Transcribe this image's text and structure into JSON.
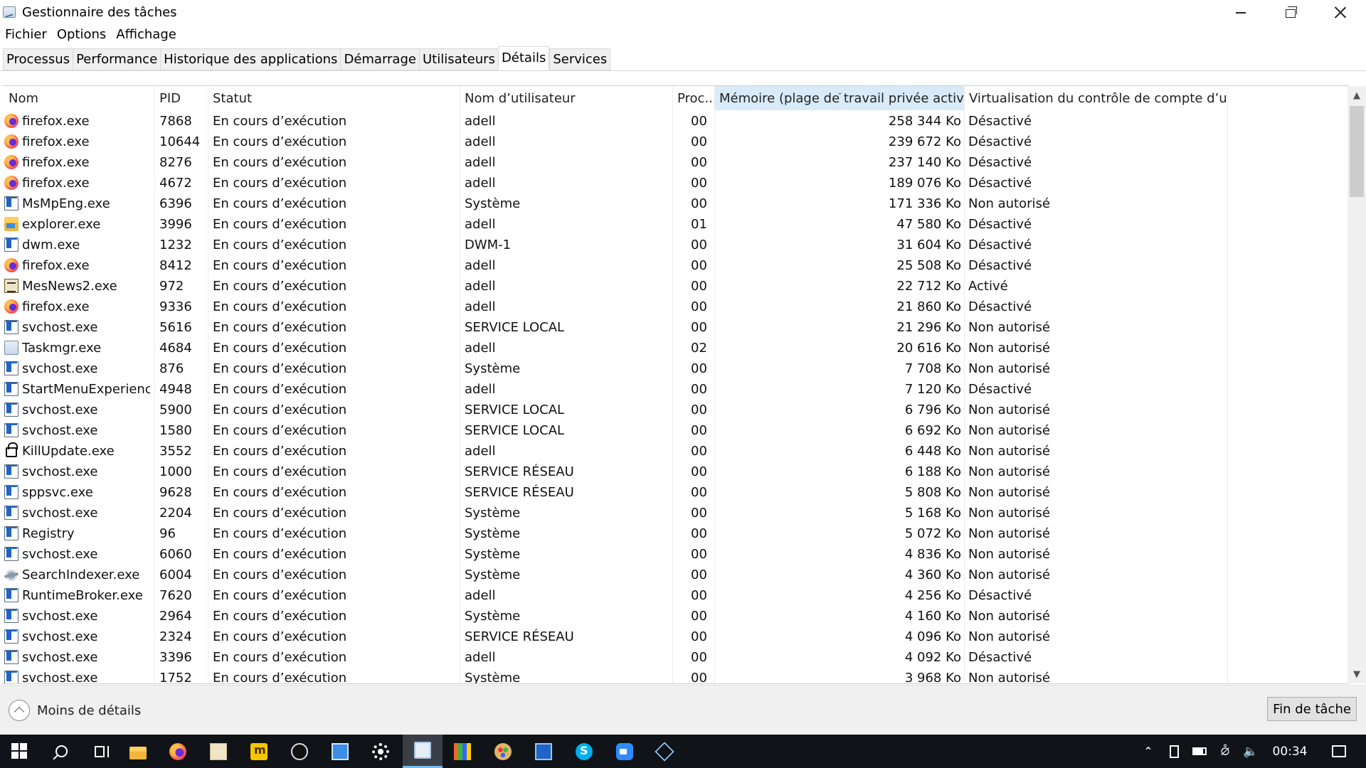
{
  "window": {
    "title": "Gestionnaire des tâches"
  },
  "menu": [
    "Fichier",
    "Options",
    "Affichage"
  ],
  "tabs": [
    {
      "label": "Processus",
      "active": false
    },
    {
      "label": "Performance",
      "active": false
    },
    {
      "label": "Historique des applications",
      "active": false
    },
    {
      "label": "Démarrage",
      "active": false
    },
    {
      "label": "Utilisateurs",
      "active": false
    },
    {
      "label": "Détails",
      "active": true
    },
    {
      "label": "Services",
      "active": false
    }
  ],
  "columns": {
    "name": "Nom",
    "pid": "PID",
    "status": "Statut",
    "user": "Nom d’utilisateur",
    "cpu": "Proc...",
    "memory": "Mémoire (plage de travail privée active)",
    "uac": "Virtualisation du contrôle de compte d’utilis..."
  },
  "sort": {
    "column": "memory",
    "direction": "descending"
  },
  "rows": [
    {
      "icon": "firefox-icon",
      "name": "firefox.exe",
      "pid": "7868",
      "status": "En cours d’exécution",
      "user": "adell",
      "cpu": "00",
      "memory": "258 344 Ko",
      "uac": "Désactivé"
    },
    {
      "icon": "firefox-icon",
      "name": "firefox.exe",
      "pid": "10644",
      "status": "En cours d’exécution",
      "user": "adell",
      "cpu": "00",
      "memory": "239 672 Ko",
      "uac": "Désactivé"
    },
    {
      "icon": "firefox-icon",
      "name": "firefox.exe",
      "pid": "8276",
      "status": "En cours d’exécution",
      "user": "adell",
      "cpu": "00",
      "memory": "237 140 Ko",
      "uac": "Désactivé"
    },
    {
      "icon": "firefox-icon",
      "name": "firefox.exe",
      "pid": "4672",
      "status": "En cours d’exécution",
      "user": "adell",
      "cpu": "00",
      "memory": "189 076 Ko",
      "uac": "Désactivé"
    },
    {
      "icon": "generic-process-icon",
      "name": "MsMpEng.exe",
      "pid": "6396",
      "status": "En cours d’exécution",
      "user": "Système",
      "cpu": "00",
      "memory": "171 336 Ko",
      "uac": "Non autorisé"
    },
    {
      "icon": "folder-icon",
      "name": "explorer.exe",
      "pid": "3996",
      "status": "En cours d’exécution",
      "user": "adell",
      "cpu": "01",
      "memory": "47 580 Ko",
      "uac": "Désactivé"
    },
    {
      "icon": "generic-process-icon",
      "name": "dwm.exe",
      "pid": "1232",
      "status": "En cours d’exécution",
      "user": "DWM-1",
      "cpu": "00",
      "memory": "31 604 Ko",
      "uac": "Désactivé"
    },
    {
      "icon": "firefox-icon",
      "name": "firefox.exe",
      "pid": "8412",
      "status": "En cours d’exécution",
      "user": "adell",
      "cpu": "00",
      "memory": "25 508 Ko",
      "uac": "Désactivé"
    },
    {
      "icon": "news-icon",
      "name": "MesNews2.exe",
      "pid": "972",
      "status": "En cours d’exécution",
      "user": "adell",
      "cpu": "00",
      "memory": "22 712 Ko",
      "uac": "Activé"
    },
    {
      "icon": "firefox-icon",
      "name": "firefox.exe",
      "pid": "9336",
      "status": "En cours d’exécution",
      "user": "adell",
      "cpu": "00",
      "memory": "21 860 Ko",
      "uac": "Désactivé"
    },
    {
      "icon": "generic-process-icon",
      "name": "svchost.exe",
      "pid": "5616",
      "status": "En cours d’exécution",
      "user": "SERVICE LOCAL",
      "cpu": "00",
      "memory": "21 296 Ko",
      "uac": "Non autorisé"
    },
    {
      "icon": "task-manager-icon",
      "name": "Taskmgr.exe",
      "pid": "4684",
      "status": "En cours d’exécution",
      "user": "adell",
      "cpu": "02",
      "memory": "20 616 Ko",
      "uac": "Non autorisé"
    },
    {
      "icon": "generic-process-icon",
      "name": "svchost.exe",
      "pid": "876",
      "status": "En cours d’exécution",
      "user": "Système",
      "cpu": "00",
      "memory": "7 708 Ko",
      "uac": "Non autorisé"
    },
    {
      "icon": "generic-process-icon",
      "name": "StartMenuExperience...",
      "pid": "4948",
      "status": "En cours d’exécution",
      "user": "adell",
      "cpu": "00",
      "memory": "7 120 Ko",
      "uac": "Désactivé"
    },
    {
      "icon": "generic-process-icon",
      "name": "svchost.exe",
      "pid": "5900",
      "status": "En cours d’exécution",
      "user": "SERVICE LOCAL",
      "cpu": "00",
      "memory": "6 796 Ko",
      "uac": "Non autorisé"
    },
    {
      "icon": "generic-process-icon",
      "name": "svchost.exe",
      "pid": "1580",
      "status": "En cours d’exécution",
      "user": "SERVICE LOCAL",
      "cpu": "00",
      "memory": "6 692 Ko",
      "uac": "Non autorisé"
    },
    {
      "icon": "lock-icon",
      "name": "KillUpdate.exe",
      "pid": "3552",
      "status": "En cours d’exécution",
      "user": "adell",
      "cpu": "00",
      "memory": "6 448 Ko",
      "uac": "Non autorisé"
    },
    {
      "icon": "generic-process-icon",
      "name": "svchost.exe",
      "pid": "1000",
      "status": "En cours d’exécution",
      "user": "SERVICE RÉSEAU",
      "cpu": "00",
      "memory": "6 188 Ko",
      "uac": "Non autorisé"
    },
    {
      "icon": "generic-process-icon",
      "name": "sppsvc.exe",
      "pid": "9628",
      "status": "En cours d’exécution",
      "user": "SERVICE RÉSEAU",
      "cpu": "00",
      "memory": "5 808 Ko",
      "uac": "Non autorisé"
    },
    {
      "icon": "generic-process-icon",
      "name": "svchost.exe",
      "pid": "2204",
      "status": "En cours d’exécution",
      "user": "Système",
      "cpu": "00",
      "memory": "5 168 Ko",
      "uac": "Non autorisé"
    },
    {
      "icon": "generic-process-icon",
      "name": "Registry",
      "pid": "96",
      "status": "En cours d’exécution",
      "user": "Système",
      "cpu": "00",
      "memory": "5 072 Ko",
      "uac": "Non autorisé"
    },
    {
      "icon": "generic-process-icon",
      "name": "svchost.exe",
      "pid": "6060",
      "status": "En cours d’exécution",
      "user": "Système",
      "cpu": "00",
      "memory": "4 836 Ko",
      "uac": "Non autorisé"
    },
    {
      "icon": "search-indexer-icon",
      "name": "SearchIndexer.exe",
      "pid": "6004",
      "status": "En cours d’exécution",
      "user": "Système",
      "cpu": "00",
      "memory": "4 360 Ko",
      "uac": "Non autorisé"
    },
    {
      "icon": "generic-process-icon",
      "name": "RuntimeBroker.exe",
      "pid": "7620",
      "status": "En cours d’exécution",
      "user": "adell",
      "cpu": "00",
      "memory": "4 256 Ko",
      "uac": "Désactivé"
    },
    {
      "icon": "generic-process-icon",
      "name": "svchost.exe",
      "pid": "2964",
      "status": "En cours d’exécution",
      "user": "Système",
      "cpu": "00",
      "memory": "4 160 Ko",
      "uac": "Non autorisé"
    },
    {
      "icon": "generic-process-icon",
      "name": "svchost.exe",
      "pid": "2324",
      "status": "En cours d’exécution",
      "user": "SERVICE RÉSEAU",
      "cpu": "00",
      "memory": "4 096 Ko",
      "uac": "Non autorisé"
    },
    {
      "icon": "generic-process-icon",
      "name": "svchost.exe",
      "pid": "3396",
      "status": "En cours d’exécution",
      "user": "adell",
      "cpu": "00",
      "memory": "4 092 Ko",
      "uac": "Désactivé"
    },
    {
      "icon": "generic-process-icon",
      "name": "svchost.exe",
      "pid": "1752",
      "status": "En cours d’exécution",
      "user": "Système",
      "cpu": "00",
      "memory": "3 968 Ko",
      "uac": "Non autorisé"
    }
  ],
  "footer": {
    "less_details": "Moins de détails",
    "end_task": "Fin de tâche"
  },
  "taskbar": {
    "pinned": [
      {
        "name": "start-button",
        "icon": "windows-logo-icon"
      },
      {
        "name": "search-button",
        "icon": "search-icon"
      },
      {
        "name": "task-view-button",
        "icon": "task-view-icon"
      },
      {
        "name": "taskbar-explorer",
        "icon": "file-explorer-icon"
      },
      {
        "name": "taskbar-firefox",
        "icon": "firefox-icon"
      },
      {
        "name": "taskbar-mesnews",
        "icon": "news-icon"
      },
      {
        "name": "taskbar-app-yellow",
        "icon": "yellow-app-icon"
      },
      {
        "name": "taskbar-app-black",
        "icon": "black-round-app-icon"
      },
      {
        "name": "taskbar-app-display",
        "icon": "display-app-icon"
      },
      {
        "name": "taskbar-settings",
        "icon": "gear-icon"
      },
      {
        "name": "taskbar-task-manager",
        "icon": "task-manager-icon",
        "active": true
      },
      {
        "name": "taskbar-app-colorful",
        "icon": "colorful-app-icon"
      },
      {
        "name": "taskbar-app-palette",
        "icon": "palette-icon"
      },
      {
        "name": "taskbar-app-blue",
        "icon": "blue-window-icon"
      },
      {
        "name": "taskbar-skype",
        "icon": "skype-icon"
      },
      {
        "name": "taskbar-zoom",
        "icon": "zoom-icon"
      },
      {
        "name": "taskbar-app-cube",
        "icon": "cube-icon"
      }
    ],
    "clock": "00:34"
  }
}
